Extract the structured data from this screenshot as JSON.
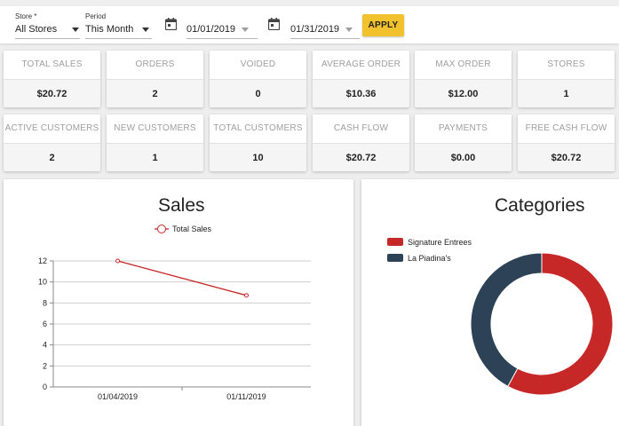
{
  "filters": {
    "store": {
      "label": "Store *",
      "value": "All Stores"
    },
    "period": {
      "label": "Period",
      "value": "This Month"
    },
    "start_date": "01/01/2019",
    "end_date": "01/31/2019",
    "apply_label": "APPLY"
  },
  "stats_row1": [
    {
      "title": "TOTAL SALES",
      "value": "$20.72"
    },
    {
      "title": "ORDERS",
      "value": "2"
    },
    {
      "title": "VOIDED",
      "value": "0"
    },
    {
      "title": "AVERAGE ORDER",
      "value": "$10.36"
    },
    {
      "title": "MAX ORDER",
      "value": "$12.00"
    },
    {
      "title": "STORES",
      "value": "1"
    }
  ],
  "stats_row2": [
    {
      "title": "ACTIVE CUSTOMERS",
      "value": "2"
    },
    {
      "title": "NEW CUSTOMERS",
      "value": "1"
    },
    {
      "title": "TOTAL CUSTOMERS",
      "value": "10"
    },
    {
      "title": "CASH FLOW",
      "value": "$20.72"
    },
    {
      "title": "PAYMENTS",
      "value": "$0.00"
    },
    {
      "title": "FREE CASH FLOW",
      "value": "$20.72"
    }
  ],
  "sales_panel": {
    "title": "Sales"
  },
  "categories_panel": {
    "title": "Categories"
  },
  "chart_data": [
    {
      "type": "line",
      "title": "Sales",
      "x": [
        "01/04/2019",
        "01/11/2019"
      ],
      "series": [
        {
          "name": "Total Sales",
          "values": [
            12.0,
            8.72
          ],
          "color": "#c62828"
        }
      ],
      "ylim": [
        0,
        12
      ],
      "yticks": [
        "0",
        "2",
        "4",
        "6",
        "8",
        "10",
        "12"
      ],
      "grid": true,
      "legend": "top"
    },
    {
      "type": "pie",
      "title": "Categories",
      "labels": [
        "Signature Entrees",
        "La Piadina's"
      ],
      "values": [
        12.0,
        8.72
      ],
      "colors": [
        "#c62828",
        "#2d4256"
      ],
      "legend": "top-left"
    }
  ]
}
